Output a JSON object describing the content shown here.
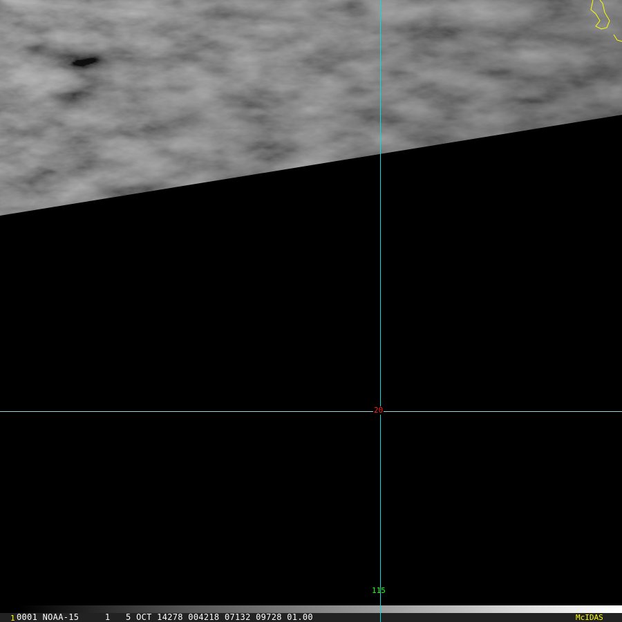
{
  "overlay": {
    "latitude_label": "20",
    "longitude_label": "115"
  },
  "status_bar": {
    "frame_number": "1",
    "info": "0001 NOAA-15     1   5 OCT 14278 004218 07132 09728 01.00",
    "brand": "McIDAS"
  },
  "colors": {
    "grid_line": "#00e0e0",
    "lat_label": "#ff2020",
    "lon_label": "#20ff20",
    "coastline": "#ffff00",
    "brand": "#ffff00"
  }
}
